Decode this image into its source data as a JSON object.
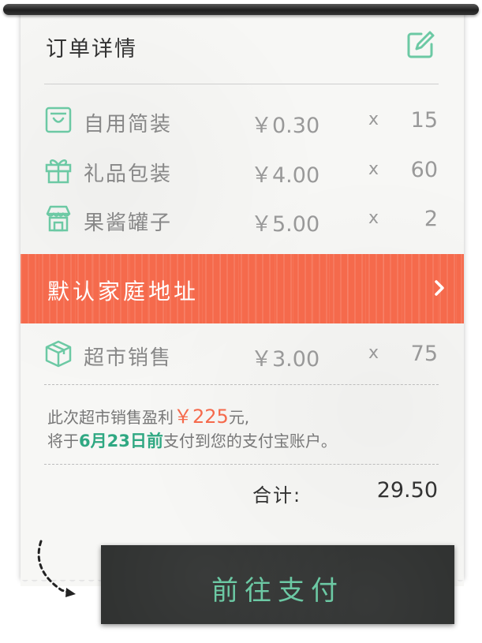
{
  "header": {
    "title": "订单详情",
    "edit_icon": "edit-icon"
  },
  "items": [
    {
      "icon": "shopping-bag-icon",
      "name": "自用简装",
      "price": "￥0.30",
      "times": "x",
      "qty": "15"
    },
    {
      "icon": "gift-icon",
      "name": "礼品包装",
      "price": "￥4.00",
      "times": "x",
      "qty": "60"
    },
    {
      "icon": "shop-stall-icon",
      "name": "果酱罐子",
      "price": "￥5.00",
      "times": "x",
      "qty": "2"
    }
  ],
  "address_banner": {
    "label": "默认家庭地址",
    "chevron_icon": "chevron-right-icon",
    "color": "#f56a4c"
  },
  "supermarket_item": {
    "icon": "package-box-icon",
    "name": "超市销售",
    "price": "￥3.00",
    "times": "x",
    "qty": "75"
  },
  "profit_note": {
    "line1_prefix": "此次超市销售盈利",
    "profit_amount": "￥225",
    "line1_suffix": "元,",
    "line2_prefix": "将于",
    "date": "6月23日前",
    "line2_suffix": "支付到您的支付宝账户。"
  },
  "total": {
    "label": "合计:",
    "value": "29.50"
  },
  "pay_button": {
    "label": "前往支付"
  },
  "colors": {
    "accent_green": "#6cc9a4",
    "accent_red": "#f56a4c",
    "button_bg": "#2d2f2e"
  }
}
